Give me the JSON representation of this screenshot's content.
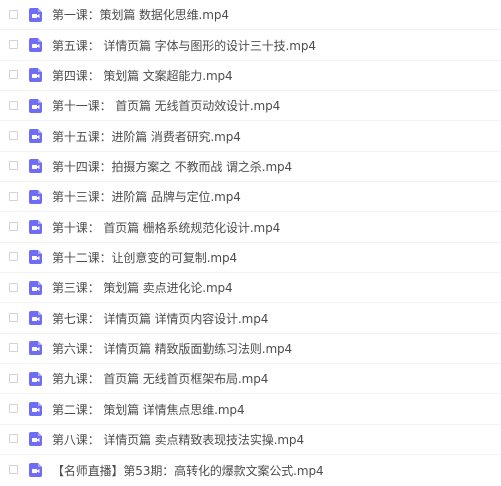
{
  "files": [
    {
      "name": "第一课：策划篇 数据化思维.mp4",
      "icon": "video-file-icon"
    },
    {
      "name": "第五课： 详情页篇 字体与图形的设计三十技.mp4",
      "icon": "video-file-icon"
    },
    {
      "name": "第四课： 策划篇 文案超能力.mp4",
      "icon": "video-file-icon"
    },
    {
      "name": "第十一课： 首页篇 无线首页动效设计.mp4",
      "icon": "video-file-icon"
    },
    {
      "name": "第十五课：进阶篇 消费者研究.mp4",
      "icon": "video-file-icon"
    },
    {
      "name": "第十四课：拍摄方案之 不教而战 谓之杀.mp4",
      "icon": "video-file-icon"
    },
    {
      "name": "第十三课：进阶篇 品牌与定位.mp4",
      "icon": "video-file-icon"
    },
    {
      "name": "第十课： 首页篇 栅格系统规范化设计.mp4",
      "icon": "video-file-icon"
    },
    {
      "name": "第十二课：让创意变的可复制.mp4",
      "icon": "video-file-icon"
    },
    {
      "name": "第三课： 策划篇 卖点进化论.mp4",
      "icon": "video-file-icon"
    },
    {
      "name": "第七课： 详情页篇 详情页内容设计.mp4",
      "icon": "video-file-icon"
    },
    {
      "name": "第六课： 详情页篇 精致版面勤练习法则.mp4",
      "icon": "video-file-icon"
    },
    {
      "name": "第九课： 首页篇 无线首页框架布局.mp4",
      "icon": "video-file-icon"
    },
    {
      "name": "第二课： 策划篇 详情焦点思维.mp4",
      "icon": "video-file-icon"
    },
    {
      "name": "第八课： 详情页篇 卖点精致表现技法实操.mp4",
      "icon": "video-file-icon"
    },
    {
      "name": "【名师直播】第53期：高转化的爆款文案公式.mp4",
      "icon": "video-file-icon"
    }
  ],
  "colors": {
    "icon_fill": "#6f6cf6",
    "text": "#4d4d4d",
    "row_divider": "#f2f2f2",
    "checkbox_border": "#d4d4d4"
  }
}
